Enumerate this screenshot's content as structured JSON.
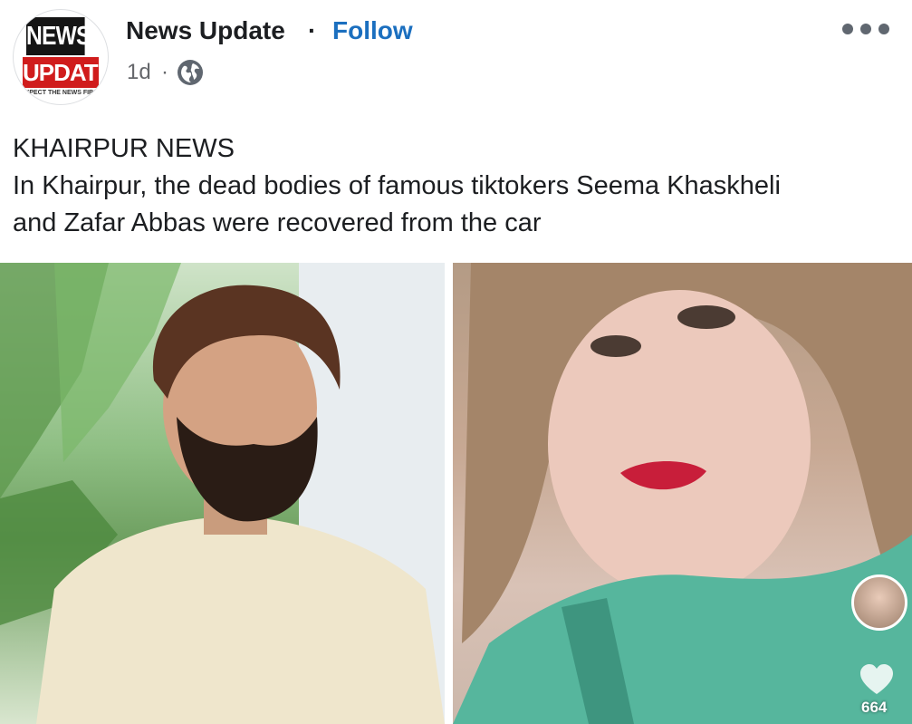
{
  "header": {
    "logo": {
      "line1": "NEWS",
      "line2": "UPDATE",
      "tagline": "EXPECT THE NEWS FIRST",
      "colors": {
        "top": "#151515",
        "bottom": "#d01c1c"
      }
    },
    "page_name": "News Update",
    "separator": "·",
    "follow_label": "Follow",
    "timestamp": "1d",
    "meta_separator": "·",
    "privacy_icon": "globe-icon",
    "more_icon": "more-options-icon"
  },
  "post": {
    "caption_lines": [
      "KHAIRPUR NEWS",
      "In Khairpur, the dead bodies of famous tiktokers Seema Khaskheli",
      "and Zafar Abbas were recovered from the car"
    ]
  },
  "media": {
    "overlay": {
      "heart_icon": "heart-icon",
      "like_count": "664"
    }
  },
  "colors": {
    "accent": "#1b6fbf",
    "text": "#1c1e21",
    "muted": "#65676b"
  }
}
